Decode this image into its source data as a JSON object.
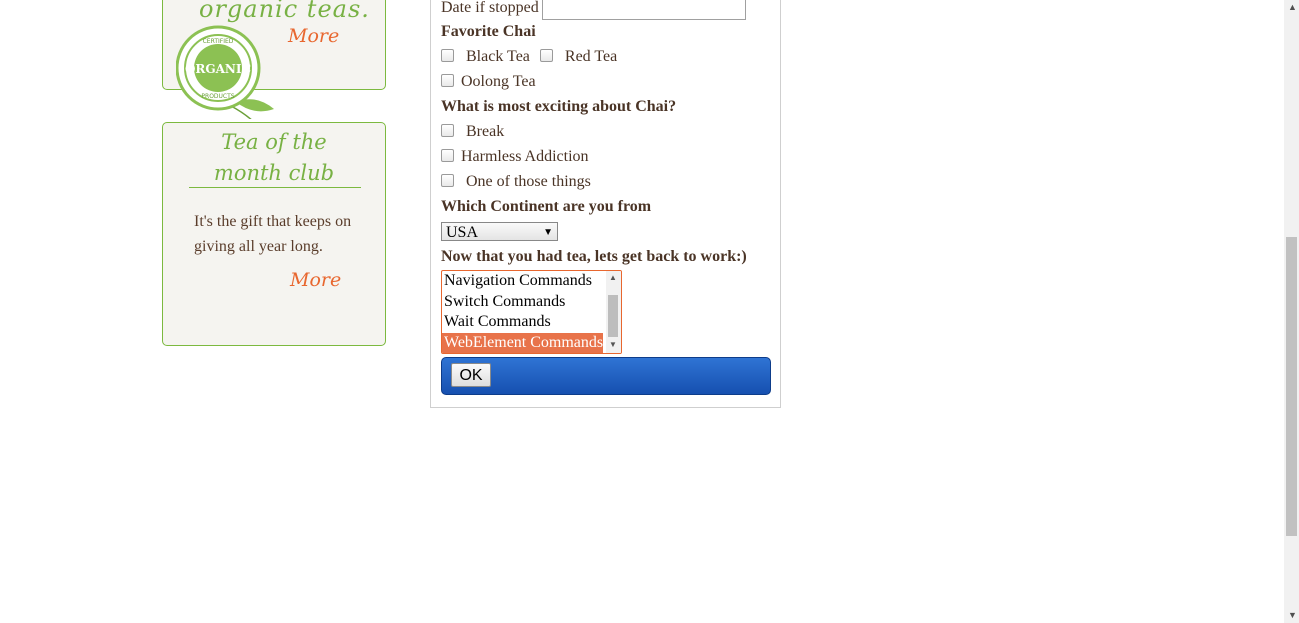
{
  "promo_organic": {
    "script_text": "organic teas.",
    "more_label": "More",
    "seal": {
      "top": "CERTIFIED",
      "main": "ORGANIC",
      "bottom": "PRODUCTS"
    }
  },
  "promo_club": {
    "title_line1": "Tea of the",
    "title_line2": "month club",
    "text": "It's the gift that keeps on giving all year long.",
    "more_label": "More"
  },
  "form": {
    "date_stopped_label": "Date if stopped",
    "date_stopped_value": "",
    "favorite_chai_heading": "Favorite Chai",
    "chai_options": [
      "Black Tea",
      "Red Tea",
      "Oolong Tea"
    ],
    "exciting_heading": "What is most exciting about Chai?",
    "exciting_options": [
      "Break",
      "Harmless Addiction",
      "One of those things"
    ],
    "continent_heading": "Which Continent are you from",
    "continent_selected": "USA",
    "back_to_work_heading": "Now that you had tea, lets get back to work:)",
    "commands": [
      "Navigation Commands",
      "Switch Commands",
      "Wait Commands",
      "WebElement Commands"
    ],
    "selected_command": "WebElement Commands",
    "ok_label": "OK"
  },
  "colors": {
    "accent_green": "#78b144",
    "accent_orange": "#e8672f",
    "button_bar_blue": "#1f5fc4",
    "text_brown": "#4a3426"
  }
}
